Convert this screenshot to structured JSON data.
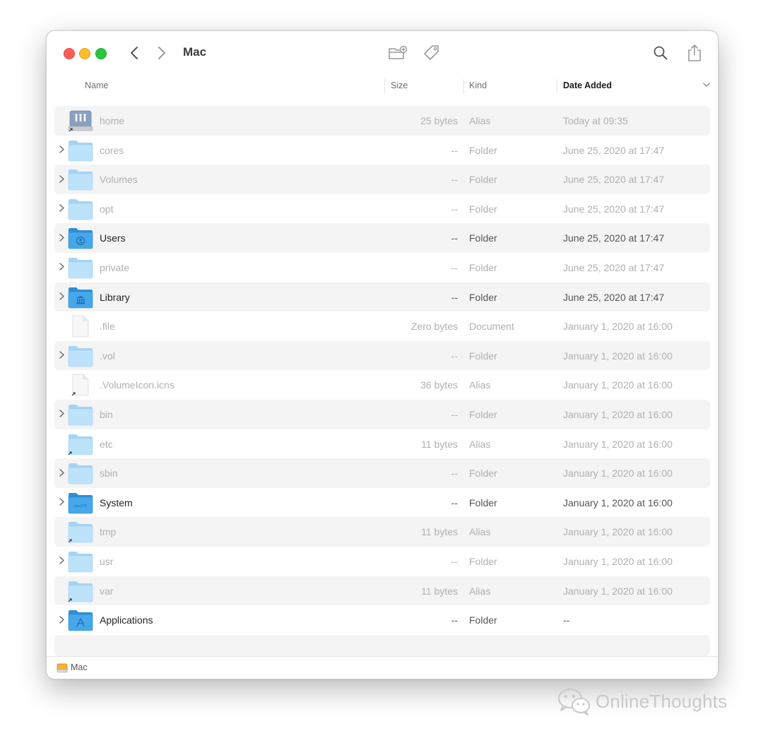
{
  "window": {
    "title": "Mac",
    "toolbar_icons": [
      "back-chevron-icon",
      "forward-chevron-icon",
      "new-folder-icon",
      "tag-icon",
      "search-icon",
      "share-icon"
    ]
  },
  "columns": {
    "name": "Name",
    "size": "Size",
    "kind": "Kind",
    "date_added": "Date Added"
  },
  "rows": [
    {
      "name": "home",
      "size": "25 bytes",
      "kind": "Alias",
      "date": "Today at 09:35",
      "icon": "network-volume-icon",
      "expandable": false,
      "dimmed": true
    },
    {
      "name": "cores",
      "size": "--",
      "kind": "Folder",
      "date": "June 25, 2020 at 17:47",
      "icon": "folder-icon",
      "expandable": true,
      "dimmed": true
    },
    {
      "name": "Volumes",
      "size": "--",
      "kind": "Folder",
      "date": "June 25, 2020 at 17:47",
      "icon": "folder-icon",
      "expandable": true,
      "dimmed": true
    },
    {
      "name": "opt",
      "size": "--",
      "kind": "Folder",
      "date": "June 25, 2020 at 17:47",
      "icon": "folder-icon",
      "expandable": true,
      "dimmed": true
    },
    {
      "name": "Users",
      "size": "--",
      "kind": "Folder",
      "date": "June 25, 2020 at 17:47",
      "icon": "users-folder-icon",
      "expandable": true,
      "dimmed": false
    },
    {
      "name": "private",
      "size": "--",
      "kind": "Folder",
      "date": "June 25, 2020 at 17:47",
      "icon": "folder-icon",
      "expandable": true,
      "dimmed": true
    },
    {
      "name": "Library",
      "size": "--",
      "kind": "Folder",
      "date": "June 25, 2020 at 17:47",
      "icon": "library-folder-icon",
      "expandable": true,
      "dimmed": false
    },
    {
      "name": ".file",
      "size": "Zero bytes",
      "kind": "Document",
      "date": "January 1, 2020 at 16:00",
      "icon": "document-icon",
      "expandable": false,
      "dimmed": true
    },
    {
      "name": ".vol",
      "size": "--",
      "kind": "Folder",
      "date": "January 1, 2020 at 16:00",
      "icon": "folder-icon",
      "expandable": true,
      "dimmed": true
    },
    {
      "name": ".VolumeIcon.icns",
      "size": "36 bytes",
      "kind": "Alias",
      "date": "January 1, 2020 at 16:00",
      "icon": "alias-document-icon",
      "expandable": false,
      "dimmed": true
    },
    {
      "name": "bin",
      "size": "--",
      "kind": "Folder",
      "date": "January 1, 2020 at 16:00",
      "icon": "folder-icon",
      "expandable": true,
      "dimmed": true
    },
    {
      "name": "etc",
      "size": "11 bytes",
      "kind": "Alias",
      "date": "January 1, 2020 at 16:00",
      "icon": "alias-folder-icon",
      "expandable": false,
      "dimmed": true
    },
    {
      "name": "sbin",
      "size": "--",
      "kind": "Folder",
      "date": "January 1, 2020 at 16:00",
      "icon": "folder-icon",
      "expandable": true,
      "dimmed": true
    },
    {
      "name": "System",
      "size": "--",
      "kind": "Folder",
      "date": "January 1, 2020 at 16:00",
      "icon": "system-folder-icon",
      "expandable": true,
      "dimmed": false,
      "badge": "macOS"
    },
    {
      "name": "tmp",
      "size": "11 bytes",
      "kind": "Alias",
      "date": "January 1, 2020 at 16:00",
      "icon": "alias-folder-icon",
      "expandable": false,
      "dimmed": true
    },
    {
      "name": "usr",
      "size": "--",
      "kind": "Folder",
      "date": "January 1, 2020 at 16:00",
      "icon": "folder-icon",
      "expandable": true,
      "dimmed": true
    },
    {
      "name": "var",
      "size": "11 bytes",
      "kind": "Alias",
      "date": "January 1, 2020 at 16:00",
      "icon": "alias-folder-icon",
      "expandable": false,
      "dimmed": true
    },
    {
      "name": "Applications",
      "size": "--",
      "kind": "Folder",
      "date": "--",
      "icon": "applications-folder-icon",
      "expandable": true,
      "dimmed": false
    }
  ],
  "pathbar": {
    "label": "Mac",
    "icon": "disk-icon"
  },
  "watermark": {
    "text": "OnlineThoughts",
    "icon": "wechat-icon"
  },
  "colors": {
    "folder_light": "#b7e0f8",
    "folder_back": "#9fd0f2",
    "folder_strong": "#3fa2e6",
    "close": "#ff5f57",
    "minimize": "#febc2e",
    "zoom": "#28c840",
    "row_alt": "#f4f4f5"
  }
}
